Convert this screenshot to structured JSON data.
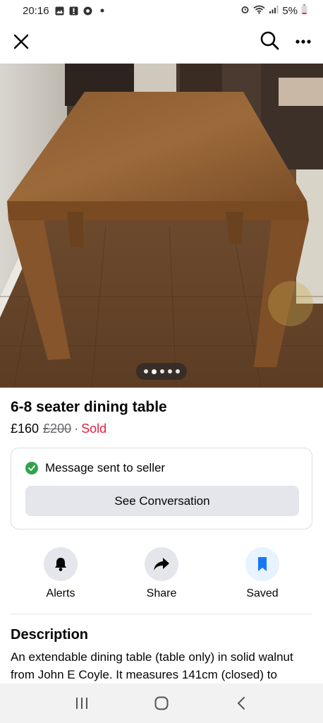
{
  "status_bar": {
    "time": "20:16",
    "battery": "5%"
  },
  "listing": {
    "title": "6-8 seater dining table",
    "price": "£160",
    "original_price": "£200",
    "separator": "·",
    "status": "Sold",
    "photo_count": 5,
    "active_photo_index": 1
  },
  "message_card": {
    "status_text": "Message sent to seller",
    "button_label": "See Conversation"
  },
  "actions": [
    {
      "label": "Alerts",
      "icon": "bell-icon"
    },
    {
      "label": "Share",
      "icon": "share-arrow-icon"
    },
    {
      "label": "Saved",
      "icon": "bookmark-icon"
    }
  ],
  "description": {
    "heading": "Description",
    "text": "An extendable dining table (table only) in solid walnut from John E Coyle. It measures 141cm (closed) to"
  },
  "colors": {
    "sold": "#e41e3f",
    "check": "#31a24c",
    "saved_accent": "#1877f2",
    "button_bg": "#e4e6eb"
  }
}
